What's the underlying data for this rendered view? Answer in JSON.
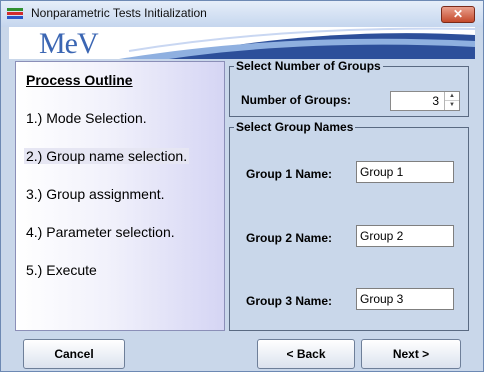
{
  "window": {
    "title": "Nonparametric Tests Initialization",
    "close_label": "✕",
    "logo_text": "MeV"
  },
  "outline": {
    "title": "Process Outline",
    "steps": [
      "1.) Mode Selection.",
      "2.) Group name selection.",
      "3.) Group assignment.",
      "4.) Parameter selection.",
      "5.) Execute"
    ],
    "current_step": 2
  },
  "groups": {
    "legend": "Select Number of Groups",
    "count_label": "Number of Groups:",
    "count_value": "3",
    "spin_up": "▲",
    "spin_down": "▼"
  },
  "names": {
    "legend": "Select Group Names",
    "rows": [
      {
        "label": "Group 1 Name:",
        "value": "Group 1"
      },
      {
        "label": "Group 2 Name:",
        "value": "Group 2"
      },
      {
        "label": "Group 3 Name:",
        "value": "Group 3"
      }
    ]
  },
  "buttons": {
    "cancel": "Cancel",
    "back": "< Back",
    "next": "Next >"
  },
  "colors": {
    "window_bg": "#c9d7ea",
    "logo_blue": "#3b66b3",
    "close_red": "#c44a2c"
  }
}
